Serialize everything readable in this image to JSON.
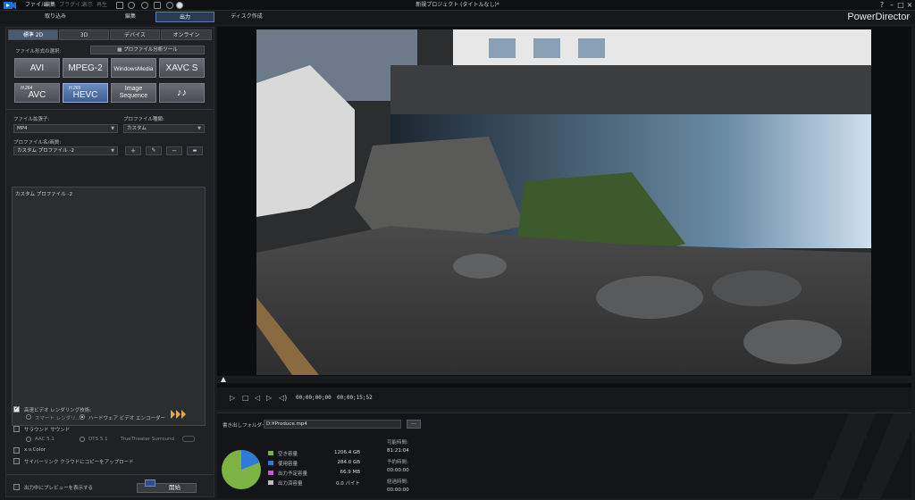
{
  "titlebar": {
    "menus": [
      "ファイル",
      "編集",
      "プラグイン",
      "表示",
      "再生"
    ],
    "title": "新規プロジェクト (タイトルなし)*",
    "window_buttons": [
      "?",
      "–",
      "□",
      "×"
    ]
  },
  "modes": {
    "tabs": [
      "取り込み",
      "編集",
      "出力",
      "ディスク作成"
    ],
    "active": "出力",
    "brand": "PowerDirector"
  },
  "left": {
    "subtabs": [
      "標準 2D",
      "3D",
      "デバイス",
      "オンライン"
    ],
    "format_label": "ファイル形式の選択:",
    "profile_tool": "プロファイル分析ツール",
    "formats": [
      {
        "small": "",
        "main": "AVI"
      },
      {
        "small": "",
        "main": "MPEG-2"
      },
      {
        "small": "",
        "main": "WindowsMedia"
      },
      {
        "small": "",
        "main": "XAVC S"
      },
      {
        "small": "H.264",
        "main": "AVC"
      },
      {
        "small": "H.265",
        "main": "HEVC"
      },
      {
        "small": "",
        "main": "Image Sequence"
      },
      {
        "small": "",
        "main": "♪♪"
      }
    ],
    "ext_label": "ファイル拡張子:",
    "ext_value": "MP4",
    "profile_type_label": "プロファイル種類:",
    "profile_type_value": "カスタム",
    "profile_name_label": "プロファイル名/画質:",
    "profile_name_value": "カスタム プロファイル -2",
    "profile_buttons": [
      "+",
      "✎",
      "−",
      "▬"
    ],
    "profile_description": "カスタム プロファイル -2",
    "fast_render_label": "高速ビデオ レンダリング技術:",
    "smart_render": "スマート レンダリ...",
    "hw_encoder": "ハードウェア ビデオ エンコーダー",
    "surround_label": "サラウンド サウンド",
    "aac": "AAC 5.1",
    "dts": "DTS 5.1",
    "truetheater": "TrueTheater Surround",
    "xvcolor": "x.v.Color",
    "cyberlink_cloud": "サイバーリンク クラウドにコピーをアップロード",
    "preview_during": "出力中にプレビューを表示する",
    "start": "開始"
  },
  "transport": {
    "time_current": "00;00;00;00",
    "time_total": "00;00;15;52"
  },
  "output": {
    "folder_label": "書き出しフォルダー:",
    "folder_value": "D:¥Produce.mp4",
    "browse": "...",
    "legend": [
      {
        "label": "空き容量",
        "value": "1206.4 GB",
        "color": "#7cb342"
      },
      {
        "label": "使用容量",
        "value": "284.0 GB",
        "color": "#2e7bd6"
      },
      {
        "label": "出力予定容量",
        "value": "66.9 MB",
        "color": "#c15bd6"
      },
      {
        "label": "出力済容量",
        "value": "0.0 バイト",
        "color": "#bdbdbd"
      }
    ],
    "pie": [
      {
        "name": "空き容量",
        "value": 1206.4
      },
      {
        "name": "使用容量",
        "value": 284.0
      }
    ],
    "times": [
      {
        "label": "可能時間:",
        "value": "81:21:04"
      },
      {
        "label": "予約時間:",
        "value": "00:00:00"
      },
      {
        "label": "経過時間:",
        "value": "00:00:00"
      }
    ]
  }
}
